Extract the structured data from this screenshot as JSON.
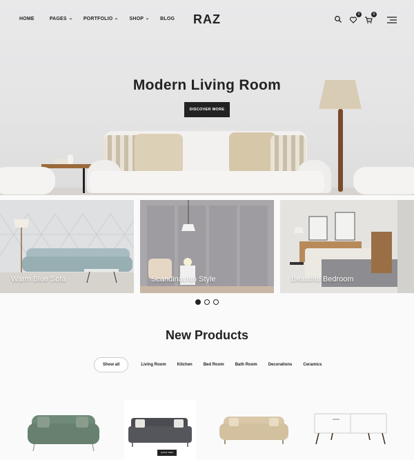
{
  "header": {
    "nav": [
      {
        "label": "HOME",
        "dropdown": false
      },
      {
        "label": "PAGES",
        "dropdown": true
      },
      {
        "label": "PORTFOLIO",
        "dropdown": true
      },
      {
        "label": "SHOP",
        "dropdown": true
      },
      {
        "label": "BLOG",
        "dropdown": false
      }
    ],
    "logo": "RAZ",
    "wishlist_count": "0",
    "cart_count": "0"
  },
  "hero": {
    "title": "Modern Living Room",
    "button": "DISCOVER MORE"
  },
  "categories": [
    {
      "label": "Warm Blue Sofa"
    },
    {
      "label": "Scandinavian Style"
    },
    {
      "label": "Beautiful Bedroom"
    }
  ],
  "slider": {
    "total": 3,
    "active": 1
  },
  "products_section": {
    "title": "New Products",
    "filters": [
      "Show all",
      "Living Room",
      "Kitchen",
      "Bed Room",
      "Bath Room",
      "Decorations",
      "Ceramics"
    ],
    "active_filter": "Show all",
    "quick_label": "QUICK VIEW"
  },
  "colors": {
    "dark": "#222222",
    "sofa_green": "#6f8a77",
    "sofa_gray": "#4a4c52",
    "sofa_beige": "#d9c7a8"
  }
}
